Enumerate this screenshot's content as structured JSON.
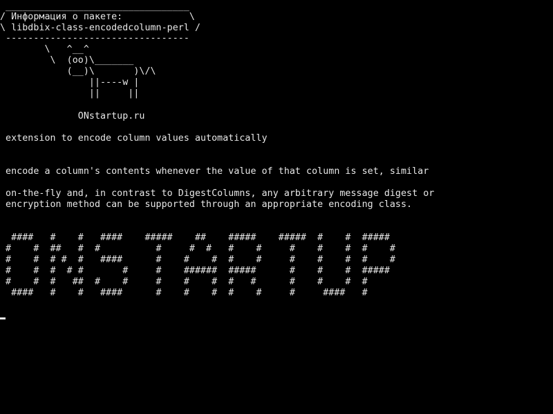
{
  "terminal": {
    "cowsay": [
      " _________________________________",
      "/ Информация о пакете:            \\",
      "\\ libdbix-class-encodedcolumn-perl /",
      " ---------------------------------",
      "        \\   ^__^",
      "         \\  (oo)\\_______",
      "            (__)\\       )\\/\\",
      "                ||----w |",
      "                ||     ||"
    ],
    "site": "              ONstartup.ru",
    "summary": " extension to encode column values automatically",
    "description": [
      " encode a column's contents whenever the value of that column is set, similar",
      " on-the-fly and, in contrast to DigestColumns, any arbitrary message digest or",
      " encryption method can be supported through an appropriate encoding class."
    ],
    "banner": [
      "  ####   #    #   ####    #####    ##    #####    #####  #    #  #####",
      " #    #  ##   #  #          #     #  #   #    #     #    #    #  #    #",
      " #    #  # #  #   ####      #    #    #  #    #     #    #    #  #    #",
      " #    #  #  # #       #     #    ######  #####      #    #    #  #####",
      " #    #  #   ##  #    #     #    #    #  #   #      #    #    #  #",
      "  ####   #    #   ####      #    #    #  #    #     #     ####   #"
    ]
  },
  "colors": {
    "background": "#000000",
    "foreground": "#e8e8e8"
  }
}
